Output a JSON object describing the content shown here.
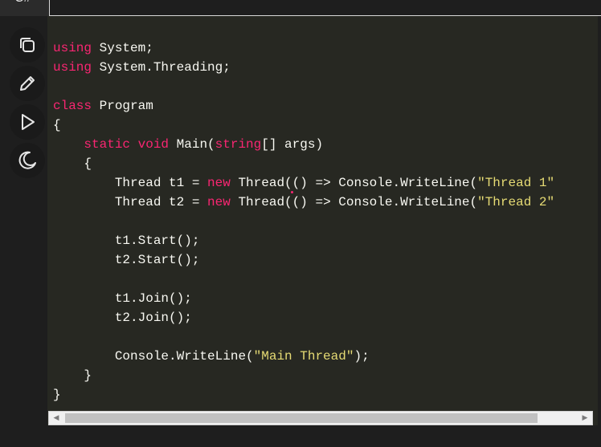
{
  "tab": {
    "label": "C#"
  },
  "toolbar": {
    "buttons": [
      {
        "name": "copy",
        "icon": "copy-icon"
      },
      {
        "name": "edit",
        "icon": "pencil-icon"
      },
      {
        "name": "run",
        "icon": "play-icon"
      },
      {
        "name": "theme",
        "icon": "moon-icon"
      }
    ]
  },
  "code": {
    "language": "csharp",
    "colors": {
      "keyword": "#f92672",
      "string": "#e6db74",
      "text": "#f8f8f2",
      "background": "#272822"
    },
    "lines": [
      [
        [
          "kw",
          "using"
        ],
        [
          "t",
          " System;"
        ]
      ],
      [
        [
          "kw",
          "using"
        ],
        [
          "t",
          " System.Threading;"
        ]
      ],
      [],
      [
        [
          "kw",
          "class"
        ],
        [
          "t",
          " Program"
        ]
      ],
      [
        [
          "t",
          "{"
        ]
      ],
      [
        [
          "t",
          "    "
        ],
        [
          "kw",
          "static"
        ],
        [
          "t",
          " "
        ],
        [
          "kw",
          "void"
        ],
        [
          "t",
          " Main("
        ],
        [
          "kw",
          "string"
        ],
        [
          "t",
          "[] args)"
        ]
      ],
      [
        [
          "t",
          "    {"
        ]
      ],
      [
        [
          "t",
          "        Thread t1 = "
        ],
        [
          "kw",
          "new"
        ],
        [
          "t",
          " Thread(() => Console.WriteLine("
        ],
        [
          "str",
          "\"Thread 1\""
        ]
      ],
      [
        [
          "t",
          "        Thread t2 = "
        ],
        [
          "kw",
          "new"
        ],
        [
          "t",
          " Thread(() => Console.WriteLine("
        ],
        [
          "str",
          "\"Thread 2\""
        ]
      ],
      [],
      [
        [
          "t",
          "        t1.Start();"
        ]
      ],
      [
        [
          "t",
          "        t2.Start();"
        ]
      ],
      [],
      [
        [
          "t",
          "        t1.Join();"
        ]
      ],
      [
        [
          "t",
          "        t2.Join();"
        ]
      ],
      [],
      [
        [
          "t",
          "        Console.WriteLine("
        ],
        [
          "str",
          "\"Main Thread\""
        ],
        [
          "t",
          ");"
        ]
      ],
      [
        [
          "t",
          "    }"
        ]
      ],
      [
        [
          "t",
          "}"
        ]
      ]
    ]
  },
  "scrollbar": {
    "left_arrow": "◀",
    "right_arrow": "▶",
    "position": 0.0
  }
}
